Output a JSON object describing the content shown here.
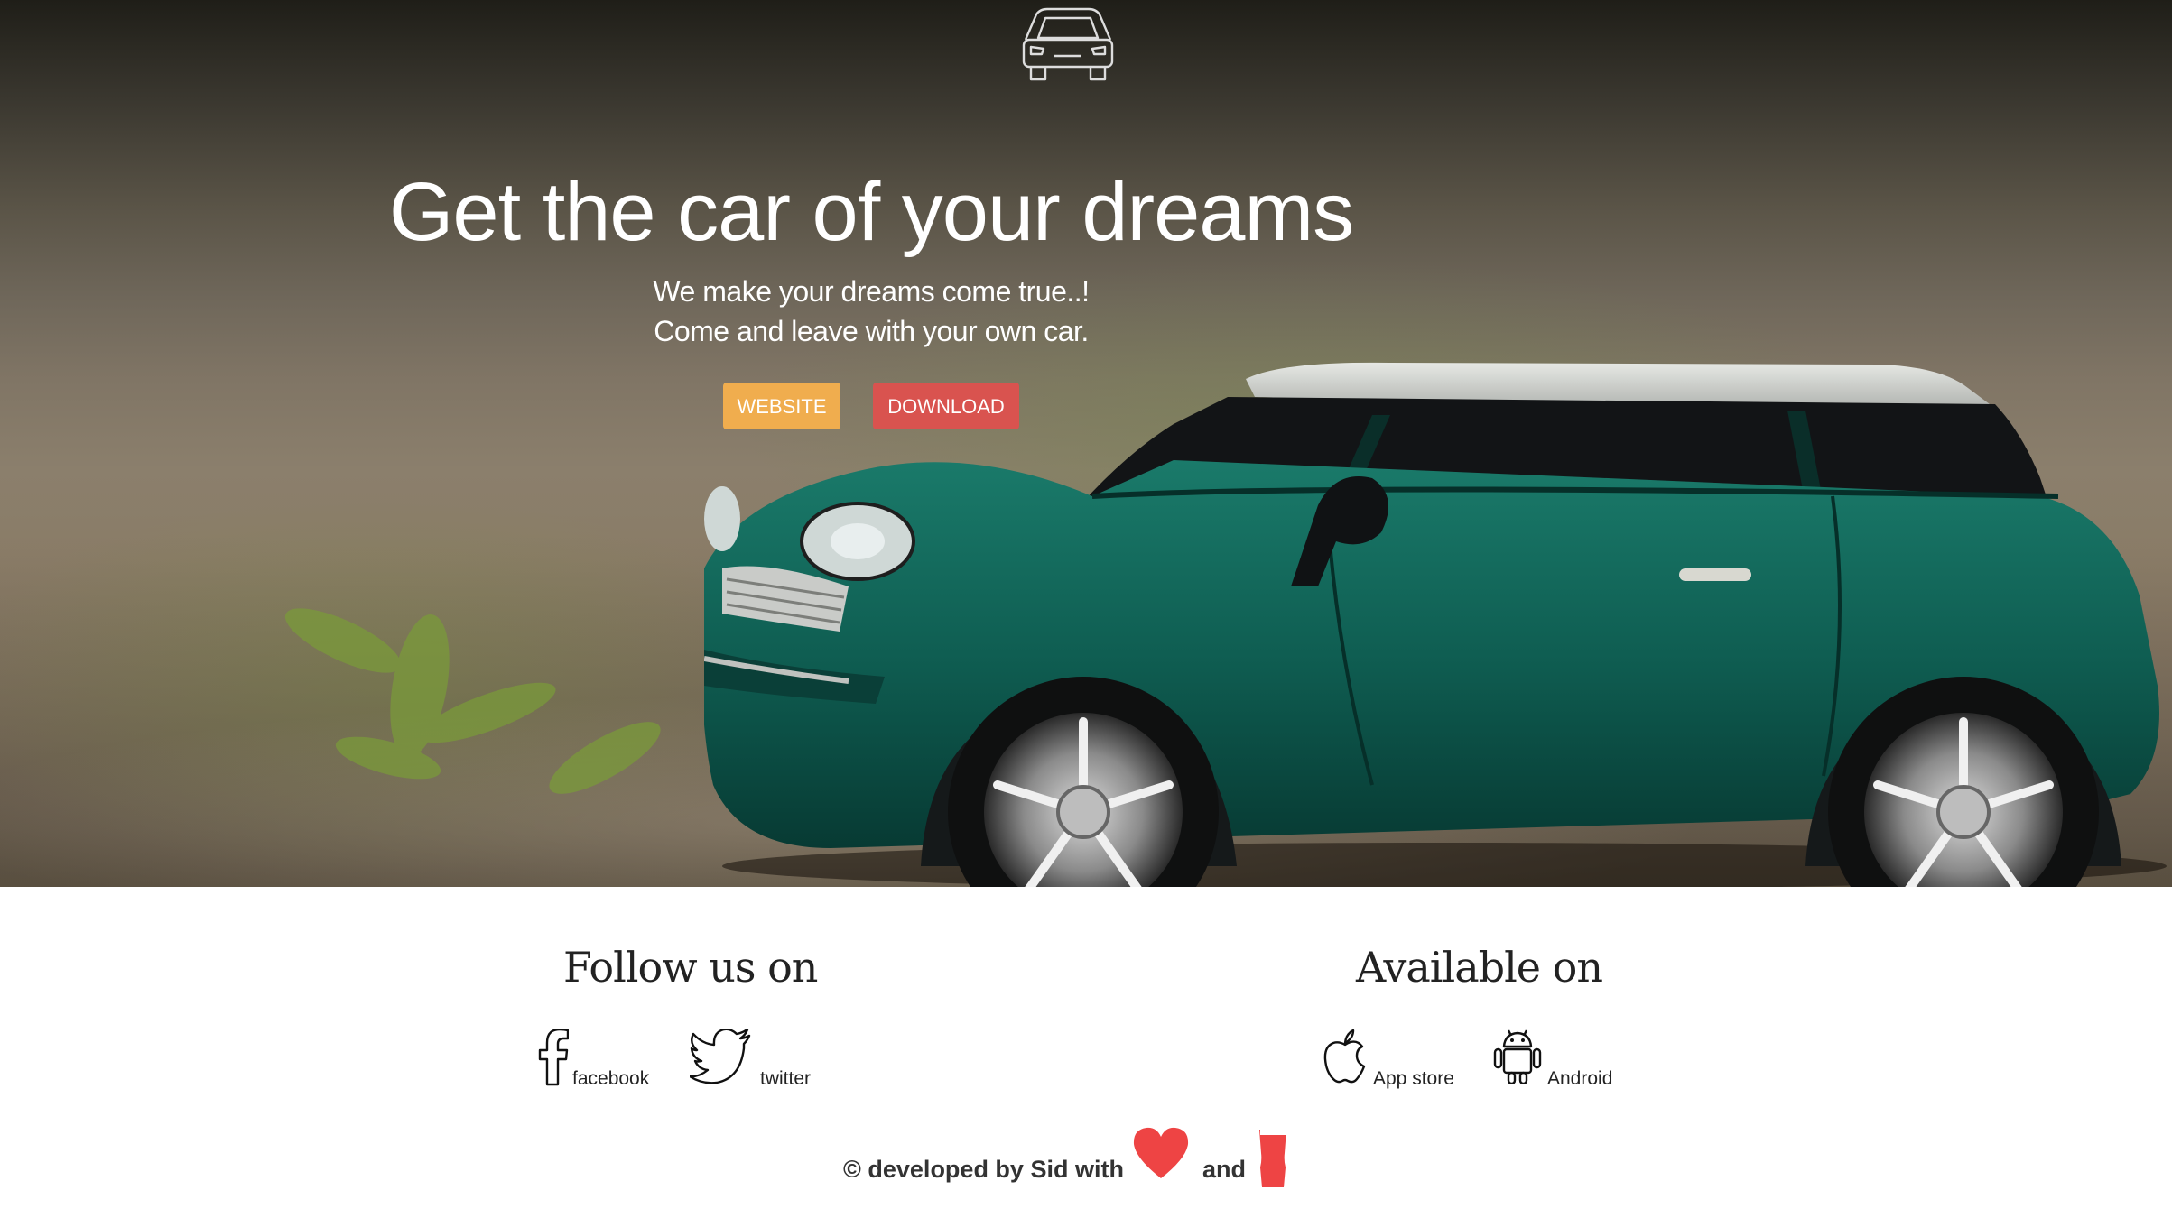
{
  "hero": {
    "headline": "Get the car of your dreams",
    "subline_1": "We make your dreams come true..!",
    "subline_2": "Come and leave with your own car.",
    "buttons": {
      "website": "WEBSITE",
      "download": "DOWNLOAD"
    },
    "logo_icon": "car-front-icon"
  },
  "follow": {
    "title": "Follow us on",
    "items": [
      {
        "label": "facebook",
        "icon": "facebook-icon"
      },
      {
        "label": "twitter",
        "icon": "twitter-icon"
      }
    ]
  },
  "available": {
    "title": "Available on",
    "items": [
      {
        "label": "App store",
        "icon": "apple-icon"
      },
      {
        "label": "Android",
        "icon": "android-icon"
      }
    ]
  },
  "credit": {
    "text_before": "© developed by Sid with",
    "text_between": "and",
    "icons": [
      "heart-icon",
      "beer-glass-icon"
    ]
  },
  "colors": {
    "website_button": "#f0ad4e",
    "download_button": "#d9534f",
    "heart": "#ee4444",
    "car_body": "#0f5e52"
  }
}
